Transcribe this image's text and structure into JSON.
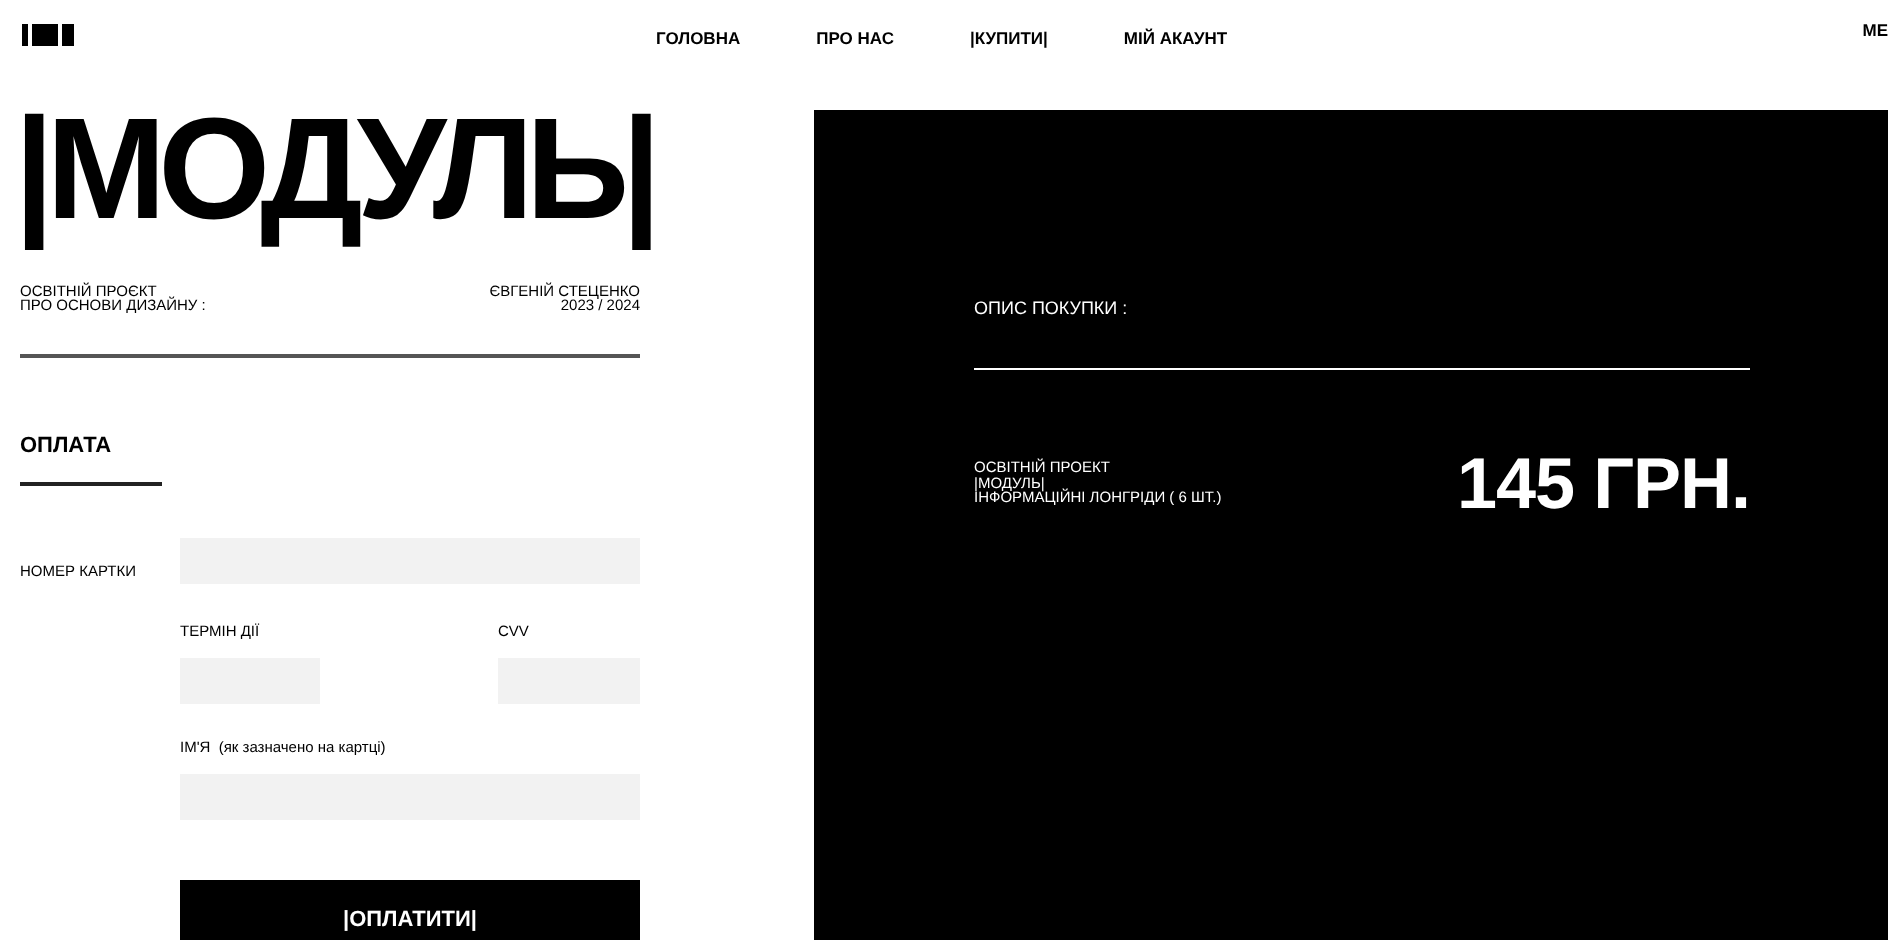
{
  "header": {
    "nav": [
      {
        "label": "ГОЛОВНА"
      },
      {
        "label": "ПРО НАС"
      },
      {
        "label": "|КУПИТИ|"
      },
      {
        "label": "МІЙ АКАУНТ"
      }
    ],
    "menu": "МЕ"
  },
  "brand": {
    "title": "|МОДУЛЬ|",
    "subtitle": [
      "ОСВІТНІЙ ПРОЄКТ",
      "ПРО ОСНОВИ ДИЗАЙНУ :"
    ],
    "author": [
      "ЄВГЕНІЙ СТЕЦЕНКО",
      "2023 / 2024"
    ]
  },
  "payment": {
    "heading": "ОПЛАТА",
    "card_label": "НОМЕР КАРТКИ",
    "expiry_label": "ТЕРМІН ДІЇ",
    "cvv_label": "CVV",
    "name_label": "ІМ'Я  (як зазначено на картці)",
    "button": "|ОПЛАТИТИ|"
  },
  "summary": {
    "heading": "ОПИС ПОКУПКИ :",
    "item": [
      "ОСВІТНІЙ ПРОЕКТ",
      "|МОДУЛЬ|",
      "ІНФОРМАЦІЙНІ ЛОНГРІДИ ( 6 ШТ.)"
    ],
    "price": "145 ГРН."
  }
}
